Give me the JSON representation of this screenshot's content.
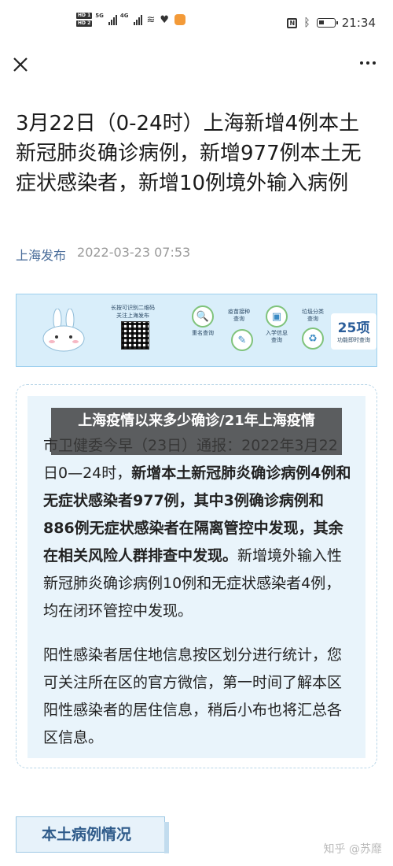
{
  "status_bar": {
    "hd1": "HD 1",
    "hd2": "HD 2",
    "sig1_label": "5G",
    "sig2_label": "4G",
    "time": "21:34"
  },
  "article": {
    "title": "3月22日（0-24时）上海新增4例本土新冠肺炎确诊病例，新增977例本土无症状感染者，新增10例境外输入病例",
    "source": "上海发布",
    "date": "2022-03-23 07:53"
  },
  "banner": {
    "qr_text": "长按可识别二维码\n关注上海发布",
    "services": [
      {
        "icon": "search-icon",
        "glyph": "🔍",
        "label": "重名查询"
      },
      {
        "icon": "search-icon",
        "glyph": "🔎",
        "label": "疫苗接种\n查询"
      },
      {
        "icon": "syringe-icon",
        "glyph": "✎",
        "label": ""
      },
      {
        "icon": "school-icon",
        "glyph": "▣",
        "label": "入学信息\n查询"
      },
      {
        "icon": "bin-icon",
        "glyph": "♻",
        "label": "垃圾分类\n查询"
      }
    ],
    "count": "25项",
    "count_sub": "功能即时查询"
  },
  "overlay_title": "上海疫情以来多少确诊/21年上海疫情",
  "notice": {
    "p1_intro": "市卫健委今早（23日）通报：2022年3月22日0—24时，",
    "p1_bold": "新增本土新冠肺炎确诊病例4例和无症状感染者977例，其中3例确诊病例和886例无症状感染者在隔离管控中发现，其余在相关风险人群排查中发现。",
    "p1_rest": "新增境外输入性新冠肺炎确诊病例10例和无症状感染者4例，均在闭环管控中发现。",
    "p2": "阳性感染者居住地信息按区划分进行统计，您可关注所在区的官方微信，第一时间了解本区阳性感染者的居住信息，稍后小布也将汇总各区信息。"
  },
  "section_tab": "本土病例情况",
  "watermark": "知乎 @苏靡"
}
